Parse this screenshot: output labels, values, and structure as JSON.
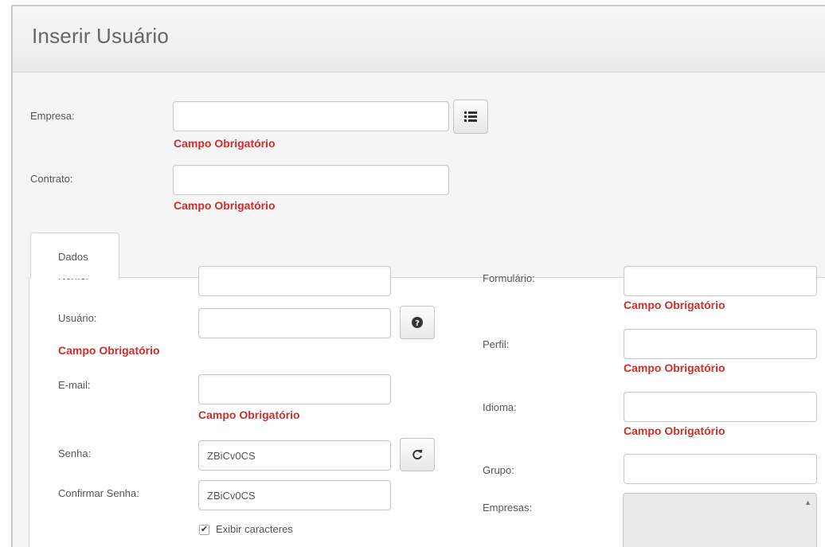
{
  "page": {
    "title": "Inserir Usuário"
  },
  "top_form": {
    "empresa": {
      "label": "Empresa:",
      "value": "",
      "required_msg": "Campo Obrigatório",
      "lookup_icon": "list-icon"
    },
    "contrato": {
      "label": "Contrato:",
      "value": "",
      "required_msg": "Campo Obrigatório"
    }
  },
  "tabs": [
    {
      "label": "Dados",
      "active": true
    }
  ],
  "left_col": {
    "nome": {
      "label": "Nome:",
      "value": ""
    },
    "usuario": {
      "label": "Usuário:",
      "value": "",
      "required_msg": "Campo Obrigatório",
      "help_icon": "question-circle-icon"
    },
    "email": {
      "label": "E-mail:",
      "value": "",
      "required_msg": "Campo Obrigatório"
    },
    "senha": {
      "label": "Senha:",
      "value": "ZBiCv0CS",
      "refresh_icon": "refresh-icon"
    },
    "confirmar_senha": {
      "label": "Confirmar Senha:",
      "value": "ZBiCv0CS"
    },
    "exibir": {
      "label": "Exibir caracteres",
      "checked": true
    }
  },
  "right_col": {
    "formulario": {
      "label": "Formulário:",
      "value": "",
      "required_msg": "Campo Obrigatório"
    },
    "perfil": {
      "label": "Perfil:",
      "value": "",
      "required_msg": "Campo Obrigatório"
    },
    "idioma": {
      "label": "Idioma:",
      "value": "",
      "required_msg": "Campo Obrigatório"
    },
    "grupo": {
      "label": "Grupo:",
      "value": ""
    },
    "empresas": {
      "label": "Empresas:"
    }
  },
  "colors": {
    "required": "#c9302c",
    "text": "#555555",
    "border": "#c8c8c8"
  }
}
